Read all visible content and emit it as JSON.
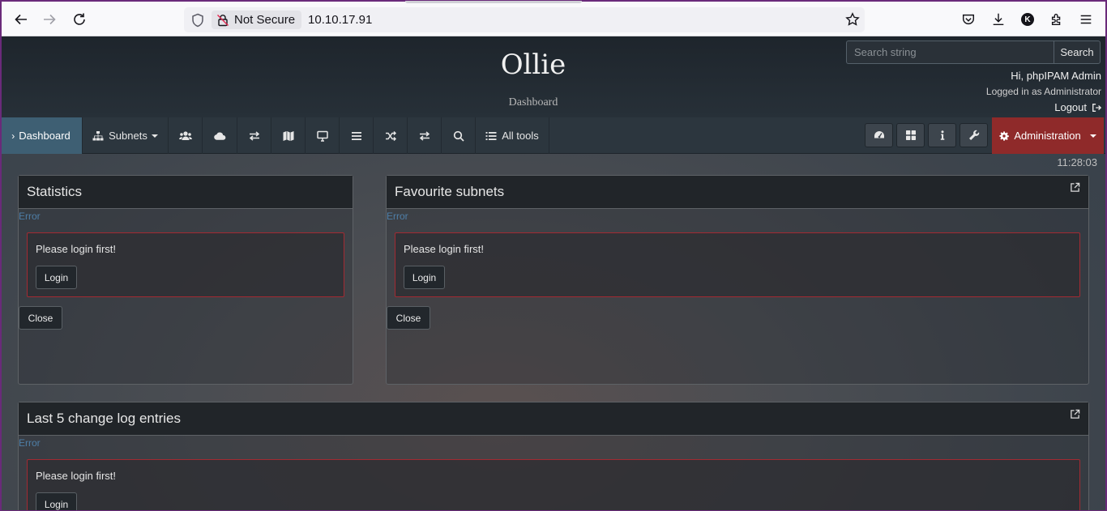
{
  "browser": {
    "security_label": "Not Secure",
    "url": "10.10.17.91",
    "profile_initial": "K"
  },
  "header": {
    "site_title": "Ollie",
    "site_subtitle": "Dashboard",
    "search_placeholder": "Search string",
    "search_button": "Search",
    "greeting": "Hi, phpIPAM Admin",
    "logged_in_as": "Logged in as  Administrator",
    "logout": "Logout"
  },
  "menu": {
    "dashboard": "Dashboard",
    "subnets": "Subnets",
    "all_tools": "All tools",
    "administration": "Administration",
    "icons": [
      "users-icon",
      "cloud-icon",
      "exchange-icon",
      "map-icon",
      "desktop-icon",
      "list-icon",
      "random-icon",
      "exchange-alt-icon",
      "search-icon"
    ]
  },
  "clock": "11:28:03",
  "widgets": {
    "statistics": {
      "title": "Statistics",
      "error_label": "Error",
      "message": "Please login first!",
      "login": "Login",
      "close": "Close"
    },
    "favourite": {
      "title": "Favourite subnets",
      "error_label": "Error",
      "message": "Please login first!",
      "login": "Login",
      "close": "Close"
    },
    "changelog": {
      "title": "Last 5 change log entries",
      "error_label": "Error",
      "message": "Please login first!",
      "login": "Login"
    }
  },
  "colors": {
    "accent_active": "#3e5f73",
    "admin": "#8f2a2a",
    "alert_border": "#a32a32",
    "error_text": "#4e7fa8"
  }
}
